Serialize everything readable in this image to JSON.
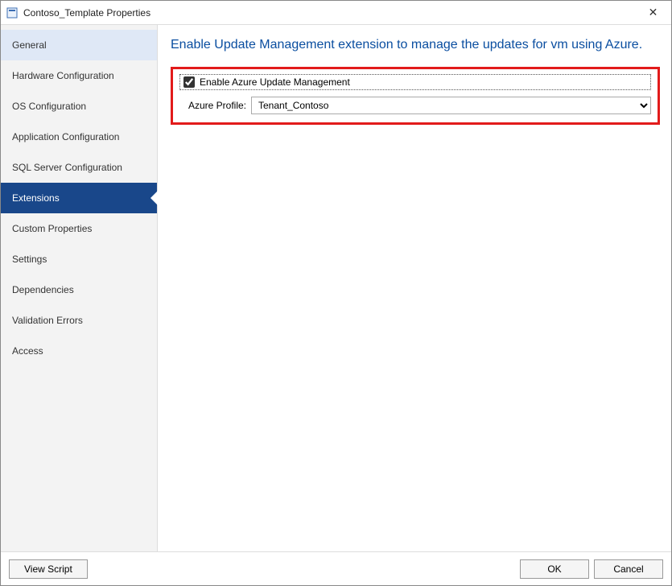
{
  "window": {
    "title": "Contoso_Template Properties",
    "close_icon": "✕"
  },
  "sidebar": {
    "items": [
      {
        "label": "General"
      },
      {
        "label": "Hardware Configuration"
      },
      {
        "label": "OS Configuration"
      },
      {
        "label": "Application Configuration"
      },
      {
        "label": "SQL Server Configuration"
      },
      {
        "label": "Extensions"
      },
      {
        "label": "Custom Properties"
      },
      {
        "label": "Settings"
      },
      {
        "label": "Dependencies"
      },
      {
        "label": "Validation Errors"
      },
      {
        "label": "Access"
      }
    ],
    "selected_index": 5
  },
  "main": {
    "heading": "Enable Update Management extension to manage the updates for vm using Azure.",
    "enable_checkbox_label": "Enable Azure Update Management",
    "enable_checkbox_checked": true,
    "profile_label": "Azure Profile:",
    "profile_value": "Tenant_Contoso"
  },
  "footer": {
    "view_script_label": "View Script",
    "ok_label": "OK",
    "cancel_label": "Cancel"
  }
}
